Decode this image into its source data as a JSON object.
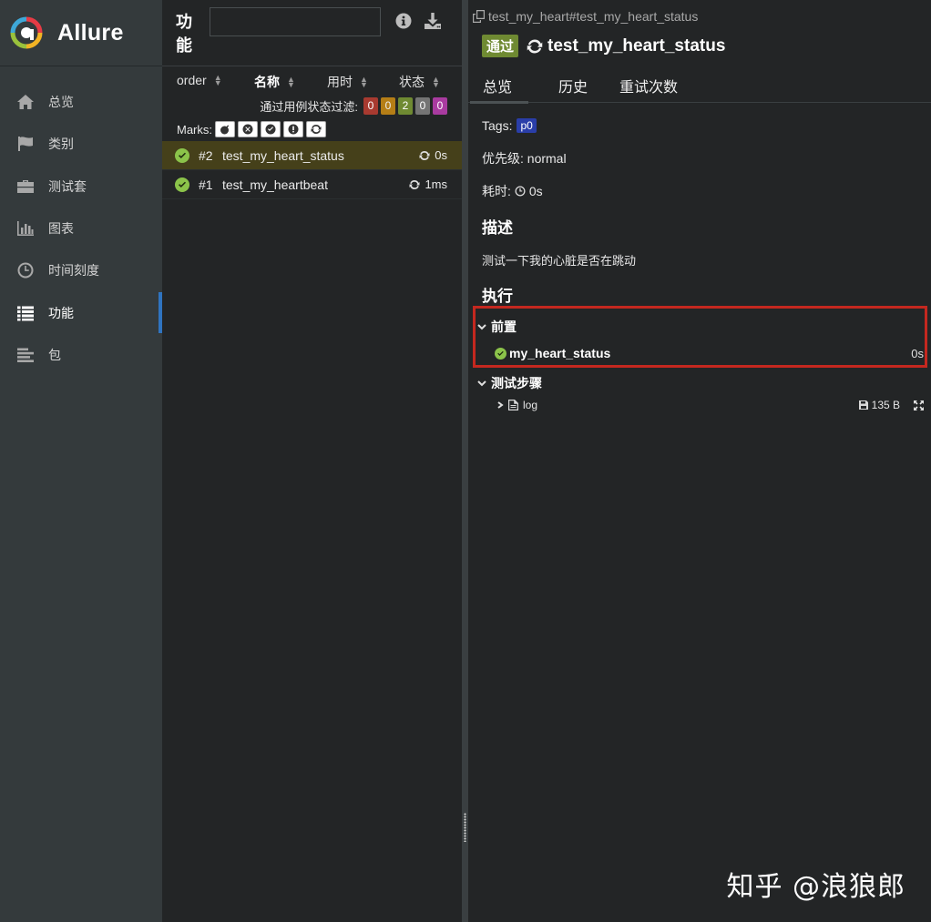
{
  "brand": {
    "name": "Allure"
  },
  "sidebar": {
    "items": [
      {
        "label": "总览",
        "icon": "home-icon"
      },
      {
        "label": "类别",
        "icon": "flag-icon"
      },
      {
        "label": "测试套",
        "icon": "briefcase-icon"
      },
      {
        "label": "图表",
        "icon": "bar-chart-icon"
      },
      {
        "label": "时间刻度",
        "icon": "clock-icon"
      },
      {
        "label": "功能",
        "icon": "list-icon",
        "active": true
      },
      {
        "label": "包",
        "icon": "align-left-icon"
      }
    ]
  },
  "tree": {
    "title": "功能",
    "search": {
      "value": "",
      "placeholder": ""
    },
    "columns": {
      "order": "order",
      "name": "名称",
      "duration": "用时",
      "status": "状态"
    },
    "filter_label": "通过用例状态过滤:",
    "status_counts": {
      "failed": "0",
      "broken": "0",
      "passed": "2",
      "skipped": "0",
      "unknown": "0"
    },
    "marks_label": "Marks:",
    "rows": [
      {
        "num": "#2",
        "name": "test_my_heart_status",
        "duration": "0s",
        "selected": true
      },
      {
        "num": "#1",
        "name": "test_my_heartbeat",
        "duration": "1ms",
        "selected": false
      }
    ]
  },
  "detail": {
    "breadcrumb": "test_my_heart#test_my_heart_status",
    "status_label": "通过",
    "title": "test_my_heart_status",
    "tabs": {
      "overview": "总览",
      "history": "历史",
      "retries": "重试次数"
    },
    "tags_label": "Tags:",
    "tag": "p0",
    "severity_label": "优先级:",
    "severity": "normal",
    "duration_label": "耗时:",
    "duration": "0s",
    "description_heading": "描述",
    "description": "测试一下我的心脏是否在跳动",
    "execution_heading": "执行",
    "setup_heading": "前置",
    "fixture": {
      "name": "my_heart_status",
      "duration": "0s"
    },
    "steps_heading": "测试步骤",
    "attachment": {
      "name": "log",
      "size": "135 B"
    }
  },
  "watermark": "知乎 @浪狼郎",
  "colors": {
    "passed": "#6f8a32",
    "failed": "#a83a30",
    "broken": "#b57e16",
    "skipped": "#747474",
    "unknown": "#a93ba0",
    "tag": "#2a3ea8",
    "accent": "#2f74c0",
    "highlight_box": "#c4281f"
  }
}
